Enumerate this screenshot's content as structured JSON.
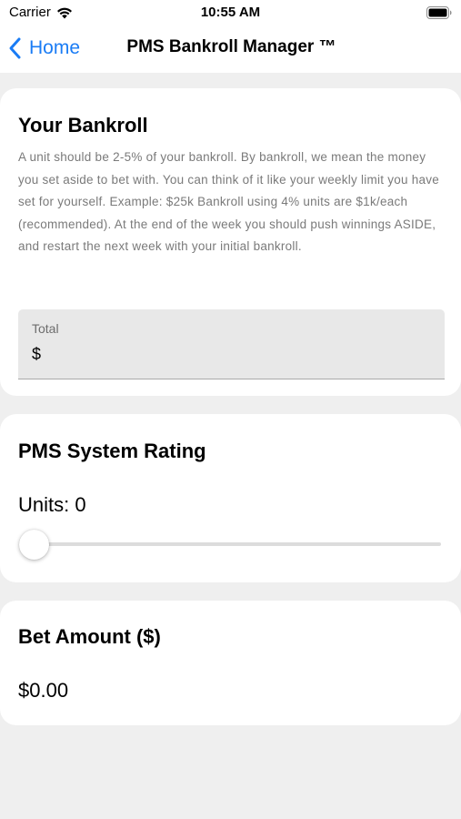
{
  "status_bar": {
    "carrier": "Carrier",
    "time": "10:55 AM",
    "wifi_icon": "wifi-icon",
    "battery_icon": "battery-icon"
  },
  "nav": {
    "back_label": "Home",
    "back_icon": "chevron-left-icon",
    "title": "PMS Bankroll Manager ™",
    "accent_color": "#1a7cf5"
  },
  "bankroll": {
    "title": "Your Bankroll",
    "description": "A unit should be 2-5% of your bankroll. By bankroll, we mean the money you set aside to bet with. You can think of it like your weekly limit you have set for yourself. Example: $25k Bankroll using 4% units are $1k/each (recommended).  At the end of the week you should push winnings ASIDE, and restart the next week with your initial bankroll.",
    "total_label": "Total",
    "total_prefix": "$",
    "total_value": ""
  },
  "rating": {
    "title": "PMS System Rating",
    "units_label": "Units: 0",
    "slider_value": 0
  },
  "bet": {
    "title": "Bet Amount ($)",
    "value": "$0.00"
  }
}
